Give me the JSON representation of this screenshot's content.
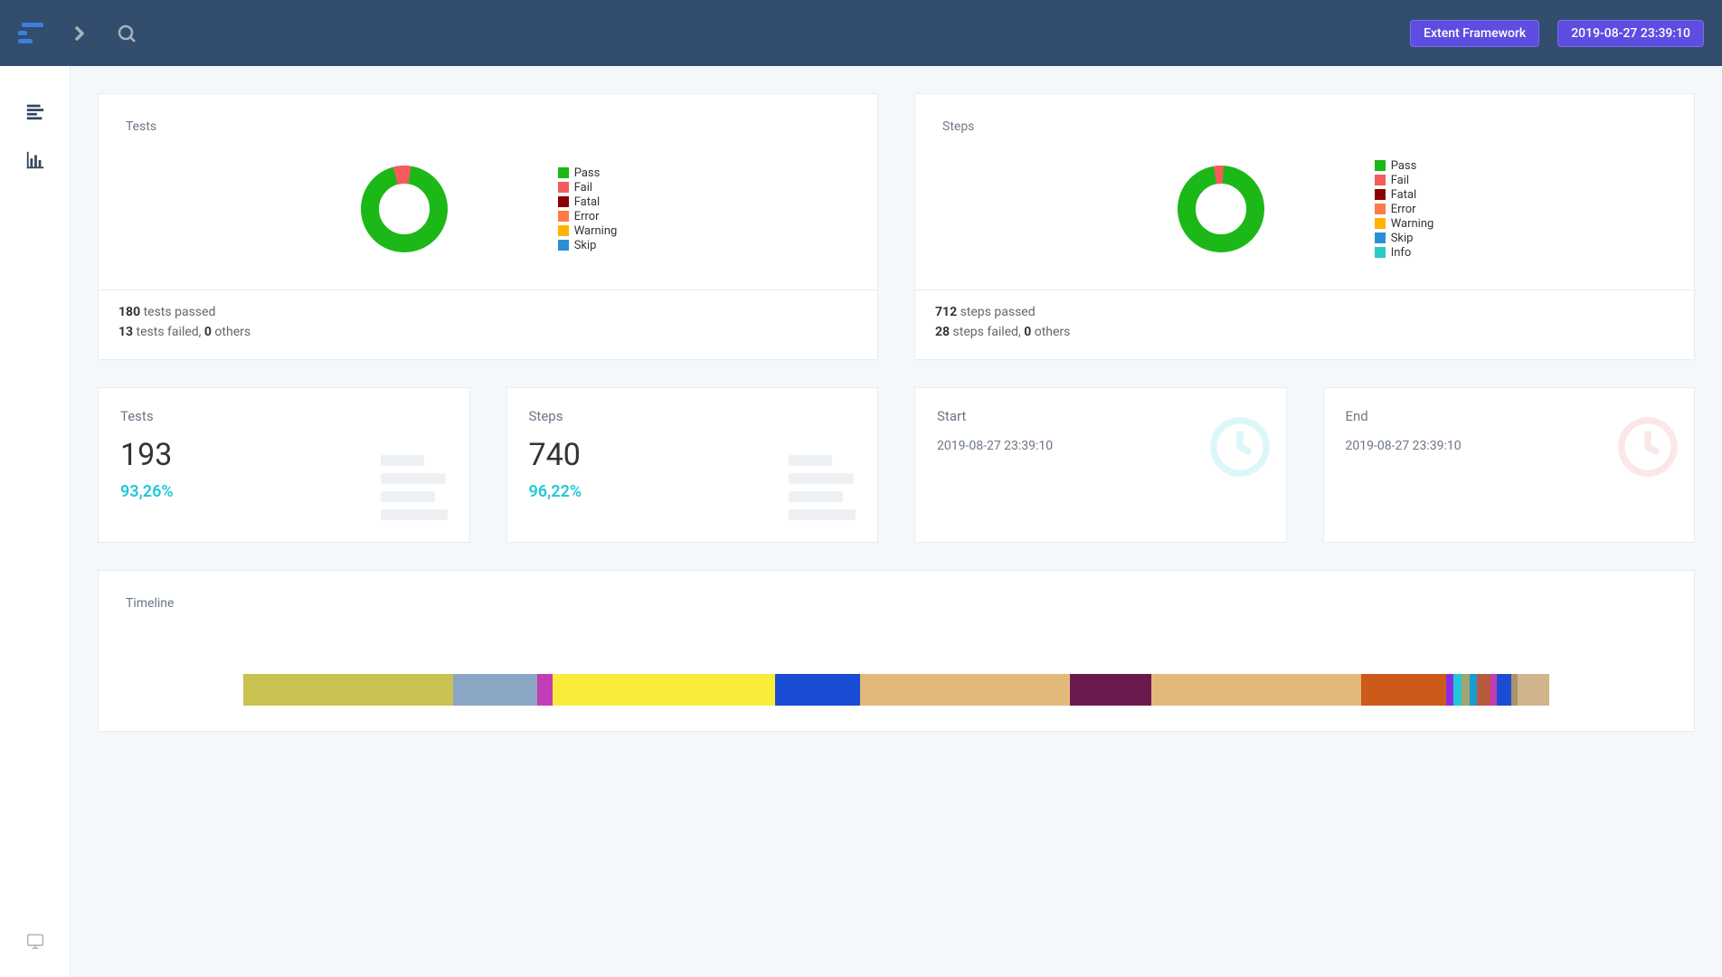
{
  "header": {
    "framework_label": "Extent Framework",
    "timestamp": "2019-08-27 23:39:10"
  },
  "chart_data": [
    {
      "type": "pie",
      "title": "Tests",
      "series": [
        {
          "name": "Pass",
          "value": 180,
          "color": "#1bb818"
        },
        {
          "name": "Fail",
          "value": 13,
          "color": "#f55b5b"
        },
        {
          "name": "Fatal",
          "value": 0,
          "color": "#8b0000"
        },
        {
          "name": "Error",
          "value": 0,
          "color": "#ff7a45"
        },
        {
          "name": "Warning",
          "value": 0,
          "color": "#ffb300"
        },
        {
          "name": "Skip",
          "value": 0,
          "color": "#2b8fd8"
        }
      ]
    },
    {
      "type": "pie",
      "title": "Steps",
      "series": [
        {
          "name": "Pass",
          "value": 712,
          "color": "#1bb818"
        },
        {
          "name": "Fail",
          "value": 28,
          "color": "#f55b5b"
        },
        {
          "name": "Fatal",
          "value": 0,
          "color": "#8b0000"
        },
        {
          "name": "Error",
          "value": 0,
          "color": "#ff7a45"
        },
        {
          "name": "Warning",
          "value": 0,
          "color": "#ffb300"
        },
        {
          "name": "Skip",
          "value": 0,
          "color": "#2b8fd8"
        },
        {
          "name": "Info",
          "value": 0,
          "color": "#2bc8c8"
        }
      ]
    }
  ],
  "tests_card": {
    "title": "Tests",
    "legend": [
      {
        "label": "Pass",
        "color": "#1bb818"
      },
      {
        "label": "Fail",
        "color": "#f55b5b"
      },
      {
        "label": "Fatal",
        "color": "#8b0000"
      },
      {
        "label": "Error",
        "color": "#ff7a45"
      },
      {
        "label": "Warning",
        "color": "#ffb300"
      },
      {
        "label": "Skip",
        "color": "#2b8fd8"
      }
    ],
    "passed_count": "180",
    "passed_label": " tests passed",
    "failed_count": "13",
    "failed_label": " tests failed, ",
    "others_count": "0",
    "others_label": " others"
  },
  "steps_card": {
    "title": "Steps",
    "legend": [
      {
        "label": "Pass",
        "color": "#1bb818"
      },
      {
        "label": "Fail",
        "color": "#f55b5b"
      },
      {
        "label": "Fatal",
        "color": "#8b0000"
      },
      {
        "label": "Error",
        "color": "#ff7a45"
      },
      {
        "label": "Warning",
        "color": "#ffb300"
      },
      {
        "label": "Skip",
        "color": "#2b8fd8"
      },
      {
        "label": "Info",
        "color": "#2bc8c8"
      }
    ],
    "passed_count": "712",
    "passed_label": " steps passed",
    "failed_count": "28",
    "failed_label": " steps failed, ",
    "others_count": "0",
    "others_label": " others"
  },
  "stats": {
    "tests": {
      "title": "Tests",
      "value": "193",
      "perc": "93,26%"
    },
    "steps": {
      "title": "Steps",
      "value": "740",
      "perc": "96,22%"
    },
    "start": {
      "title": "Start",
      "value": "2019-08-27 23:39:10"
    },
    "end": {
      "title": "End",
      "value": "2019-08-27 23:39:10"
    }
  },
  "timeline": {
    "title": "Timeline",
    "segments": [
      {
        "color": "#c8c251",
        "width": 16.1
      },
      {
        "color": "#8ba5c5",
        "width": 6.4
      },
      {
        "color": "#c23db5",
        "width": 1.2
      },
      {
        "color": "#f9ec3b",
        "width": 17.0
      },
      {
        "color": "#1a4dd4",
        "width": 6.5
      },
      {
        "color": "#e3b97a",
        "width": 16.1
      },
      {
        "color": "#6a1a4d",
        "width": 6.2
      },
      {
        "color": "#e3b97a",
        "width": 16.1
      },
      {
        "color": "#cc5a1a",
        "width": 6.5
      },
      {
        "color": "#8a2be2",
        "width": 0.6
      },
      {
        "color": "#1fc8d8",
        "width": 0.6
      },
      {
        "color": "#a0a570",
        "width": 0.6
      },
      {
        "color": "#1a9bd4",
        "width": 0.6
      },
      {
        "color": "#b85a3e",
        "width": 1.0
      },
      {
        "color": "#c23db5",
        "width": 0.5
      },
      {
        "color": "#1a4dd4",
        "width": 1.1
      },
      {
        "color": "#ab9370",
        "width": 0.5
      },
      {
        "color": "#d2b48c",
        "width": 2.4
      }
    ]
  }
}
